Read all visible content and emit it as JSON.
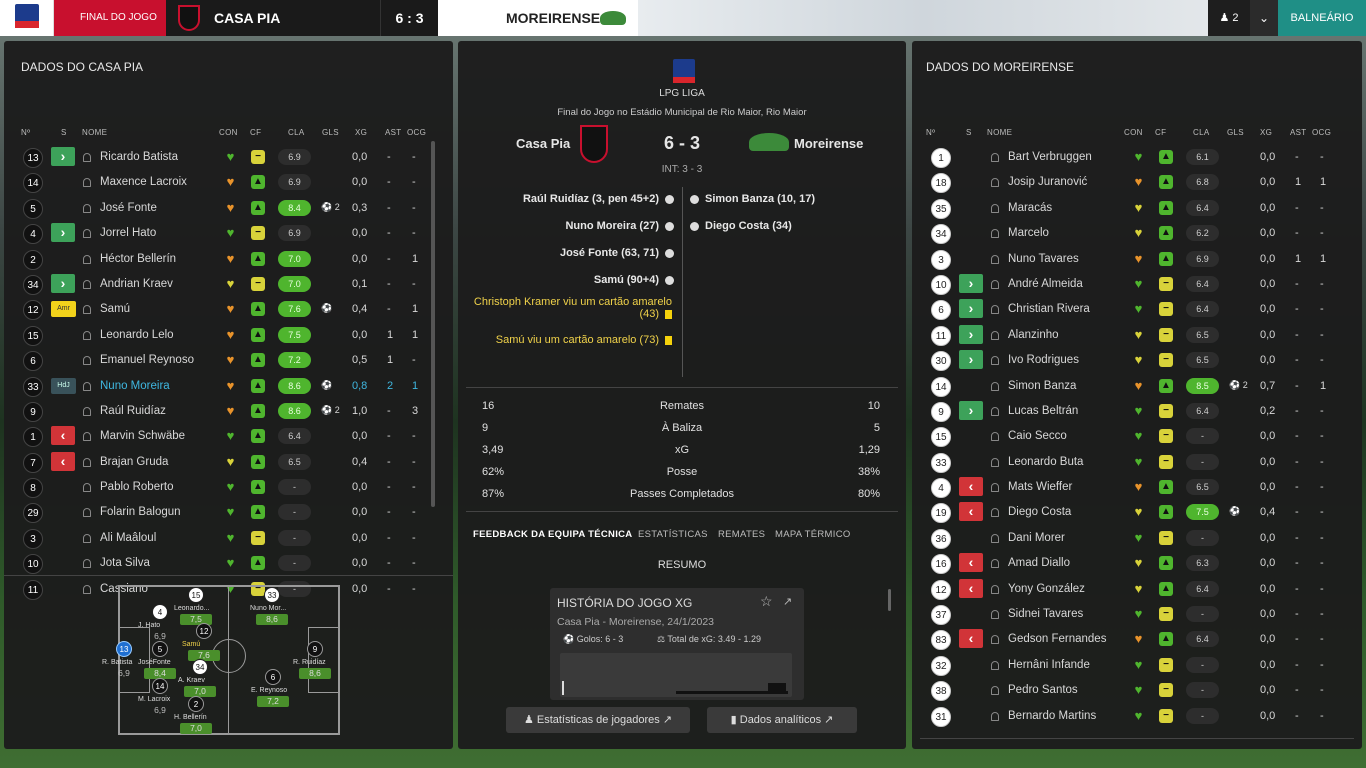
{
  "topbar": {
    "final_label": "FINAL DO JOGO",
    "home": "CASA PIA",
    "score": "6 : 3",
    "away": "MOREIRENSE",
    "users": "2",
    "balneario": "BALNEÁRIO"
  },
  "left": {
    "title": "DADOS DO CASA PIA",
    "headers": {
      "no": "Nº",
      "s": "S",
      "name": "NOME",
      "con": "CON",
      "cf": "CF",
      "cla": "CLA",
      "gls": "GLS",
      "xg": "XG",
      "ast": "AST",
      "ocg": "OCG"
    },
    "players": [
      {
        "no": "13",
        "sub": "in",
        "name": "Ricardo Batista",
        "con": "g",
        "cf": "y",
        "cla": "6.9",
        "gls": "",
        "xg": "0,0",
        "ast": "-",
        "ocg": "-"
      },
      {
        "no": "14",
        "sub": "",
        "name": "Maxence Lacroix",
        "con": "o",
        "cf": "g",
        "cla": "6.9",
        "gls": "",
        "xg": "0,0",
        "ast": "-",
        "ocg": "-"
      },
      {
        "no": "5",
        "sub": "",
        "name": "José Fonte",
        "con": "o",
        "cf": "g",
        "cla": "8.4",
        "gls": "2",
        "xg": "0,3",
        "ast": "-",
        "ocg": "-"
      },
      {
        "no": "4",
        "sub": "in",
        "name": "Jorrel Hato",
        "con": "g",
        "cf": "y",
        "cla": "6.9",
        "gls": "",
        "xg": "0,0",
        "ast": "-",
        "ocg": "-"
      },
      {
        "no": "2",
        "sub": "",
        "name": "Héctor Bellerín",
        "con": "o",
        "cf": "g",
        "cla": "7.0",
        "gls": "",
        "xg": "0,0",
        "ast": "-",
        "ocg": "1"
      },
      {
        "no": "34",
        "sub": "in",
        "name": "Andrian Kraev",
        "con": "y",
        "cf": "y",
        "cla": "7.0",
        "gls": "",
        "xg": "0,1",
        "ast": "-",
        "ocg": "-"
      },
      {
        "no": "12",
        "sub": "amr",
        "name": "Samú",
        "con": "o",
        "cf": "g",
        "cla": "7.6",
        "gls": "1",
        "xg": "0,4",
        "ast": "-",
        "ocg": "1"
      },
      {
        "no": "15",
        "sub": "",
        "name": "Leonardo Lelo",
        "con": "o",
        "cf": "g",
        "cla": "7.5",
        "gls": "",
        "xg": "0,0",
        "ast": "1",
        "ocg": "1"
      },
      {
        "no": "6",
        "sub": "",
        "name": "Emanuel Reynoso",
        "con": "o",
        "cf": "g",
        "cla": "7.2",
        "gls": "",
        "xg": "0,5",
        "ast": "1",
        "ocg": "-"
      },
      {
        "no": "33",
        "sub": "hdj",
        "name": "Nuno Moreira",
        "con": "o",
        "cf": "g",
        "cla": "8.6",
        "gls": "1",
        "xg": "0,8",
        "ast": "2",
        "ocg": "1"
      },
      {
        "no": "9",
        "sub": "",
        "name": "Raúl Ruidíaz",
        "con": "o",
        "cf": "g",
        "cla": "8.6",
        "gls": "2",
        "xg": "1,0",
        "ast": "-",
        "ocg": "3"
      },
      {
        "no": "1",
        "sub": "out",
        "name": "Marvin Schwäbe",
        "con": "g",
        "cf": "g",
        "cla": "6.4",
        "gls": "",
        "xg": "0,0",
        "ast": "-",
        "ocg": "-"
      },
      {
        "no": "7",
        "sub": "out",
        "name": "Brajan Gruda",
        "con": "y",
        "cf": "g",
        "cla": "6.5",
        "gls": "",
        "xg": "0,4",
        "ast": "-",
        "ocg": "-"
      },
      {
        "no": "8",
        "sub": "",
        "name": "Pablo Roberto",
        "con": "g",
        "cf": "g",
        "cla": "-",
        "gls": "",
        "xg": "0,0",
        "ast": "-",
        "ocg": "-"
      },
      {
        "no": "29",
        "sub": "",
        "name": "Folarin Balogun",
        "con": "g",
        "cf": "g",
        "cla": "-",
        "gls": "",
        "xg": "0,0",
        "ast": "-",
        "ocg": "-"
      },
      {
        "no": "3",
        "sub": "",
        "name": "Ali Maâloul",
        "con": "g",
        "cf": "y",
        "cla": "-",
        "gls": "",
        "xg": "0,0",
        "ast": "-",
        "ocg": "-"
      },
      {
        "no": "10",
        "sub": "",
        "name": "Jota Silva",
        "con": "g",
        "cf": "g",
        "cla": "-",
        "gls": "",
        "xg": "0,0",
        "ast": "-",
        "ocg": "-"
      },
      {
        "no": "11",
        "sub": "",
        "name": "Cassiano",
        "con": "g",
        "cf": "y",
        "cla": "-",
        "gls": "",
        "xg": "0,0",
        "ast": "-",
        "ocg": "-"
      }
    ],
    "formation": [
      {
        "no": "15",
        "name": "Leonardo...",
        "rating": "7,5"
      },
      {
        "no": "33",
        "name": "Nuno Mor...",
        "rating": "8,6"
      },
      {
        "no": "4",
        "name": "J. Hato",
        "rating": "6,9"
      },
      {
        "no": "12",
        "name": "Samú",
        "rating": "7,6"
      },
      {
        "no": "13",
        "name": "R. Batista",
        "rating": "6,9"
      },
      {
        "no": "5",
        "name": "JoséFonte",
        "rating": "8,4"
      },
      {
        "no": "34",
        "name": "A. Kraev",
        "rating": "7,0"
      },
      {
        "no": "9",
        "name": "R. Ruidíaz",
        "rating": "8,6"
      },
      {
        "no": "14",
        "name": "M. Lacroix",
        "rating": "6,9"
      },
      {
        "no": "6",
        "name": "E. Reynoso",
        "rating": "7,2"
      },
      {
        "no": "2",
        "name": "H. Bellerín",
        "rating": "7,0"
      }
    ]
  },
  "center": {
    "league": "LPG LIGA",
    "subtitle": "Final do Jogo no Estádio Municipal de Rio Maior, Rio Maior",
    "home": "Casa Pia",
    "away": "Moreirense",
    "score": "6 - 3",
    "int": "INT: 3 - 3",
    "home_events": [
      "Raúl Ruidíaz (3, pen 45+2)",
      "Nuno Moreira (27)",
      "José Fonte (63, 71)",
      "Samú (90+4)"
    ],
    "cards": [
      "Christoph Kramer viu um cartão amarelo (43)",
      "Samú viu um cartão amarelo (73)"
    ],
    "away_events": [
      "Simon Banza (10, 17)",
      "Diego Costa (34)"
    ],
    "stats": [
      {
        "home": "16",
        "label": "Remates",
        "away": "10"
      },
      {
        "home": "9",
        "label": "À Baliza",
        "away": "5"
      },
      {
        "home": "3,49",
        "label": "xG",
        "away": "1,29"
      },
      {
        "home": "62%",
        "label": "Posse",
        "away": "38%"
      },
      {
        "home": "87%",
        "label": "Passes Completados",
        "away": "80%"
      }
    ],
    "tabs": [
      "FEEDBACK DA EQUIPA TÉCNICA",
      "ESTATÍSTICAS",
      "REMATES",
      "MAPA TÉRMICO"
    ],
    "resumo": "RESUMO",
    "card_title": "HISTÓRIA DO JOGO XG",
    "card_sub": "Casa Pia - Moreirense, 24/1/2023",
    "goals": "Golos: 6 - 3",
    "total_xg": "Total de xG: 3.49 - 1.29",
    "btn1": "Estatísticas de jogadores",
    "btn2": "Dados analíticos"
  },
  "right": {
    "title": "DADOS DO MOREIRENSE",
    "players": [
      {
        "no": "1",
        "sub": "",
        "name": "Bart Verbruggen",
        "con": "g",
        "cf": "g",
        "cla": "6.1",
        "gls": "",
        "xg": "0,0",
        "ast": "-",
        "ocg": "-"
      },
      {
        "no": "18",
        "sub": "",
        "name": "Josip Juranović",
        "con": "o",
        "cf": "g",
        "cla": "6.8",
        "gls": "",
        "xg": "0,0",
        "ast": "1",
        "ocg": "1"
      },
      {
        "no": "35",
        "sub": "",
        "name": "Maracás",
        "con": "y",
        "cf": "g",
        "cla": "6.4",
        "gls": "",
        "xg": "0,0",
        "ast": "-",
        "ocg": "-"
      },
      {
        "no": "34",
        "sub": "",
        "name": "Marcelo",
        "con": "y",
        "cf": "g",
        "cla": "6.2",
        "gls": "",
        "xg": "0,0",
        "ast": "-",
        "ocg": "-"
      },
      {
        "no": "3",
        "sub": "",
        "name": "Nuno Tavares",
        "con": "o",
        "cf": "g",
        "cla": "6.9",
        "gls": "",
        "xg": "0,0",
        "ast": "1",
        "ocg": "1"
      },
      {
        "no": "10",
        "sub": "in",
        "name": "André Almeida",
        "con": "g",
        "cf": "y",
        "cla": "6.4",
        "gls": "",
        "xg": "0,0",
        "ast": "-",
        "ocg": "-"
      },
      {
        "no": "6",
        "sub": "in",
        "name": "Christian Rivera",
        "con": "g",
        "cf": "y",
        "cla": "6.4",
        "gls": "",
        "xg": "0,0",
        "ast": "-",
        "ocg": "-"
      },
      {
        "no": "11",
        "sub": "in",
        "name": "Alanzinho",
        "con": "y",
        "cf": "y",
        "cla": "6.5",
        "gls": "",
        "xg": "0,0",
        "ast": "-",
        "ocg": "-"
      },
      {
        "no": "30",
        "sub": "in",
        "name": "Ivo Rodrigues",
        "con": "y",
        "cf": "y",
        "cla": "6.5",
        "gls": "",
        "xg": "0,0",
        "ast": "-",
        "ocg": "-"
      },
      {
        "no": "14",
        "sub": "",
        "name": "Simon Banza",
        "con": "o",
        "cf": "g",
        "cla": "8.5",
        "gls": "2",
        "xg": "0,7",
        "ast": "-",
        "ocg": "1"
      },
      {
        "no": "9",
        "sub": "in",
        "name": "Lucas Beltrán",
        "con": "g",
        "cf": "y",
        "cla": "6.4",
        "gls": "",
        "xg": "0,2",
        "ast": "-",
        "ocg": "-"
      },
      {
        "no": "15",
        "sub": "",
        "name": "Caio Secco",
        "con": "g",
        "cf": "y",
        "cla": "-",
        "gls": "",
        "xg": "0,0",
        "ast": "-",
        "ocg": "-"
      },
      {
        "no": "33",
        "sub": "",
        "name": "Leonardo Buta",
        "con": "g",
        "cf": "y",
        "cla": "-",
        "gls": "",
        "xg": "0,0",
        "ast": "-",
        "ocg": "-"
      },
      {
        "no": "4",
        "sub": "out",
        "name": "Mats Wieffer",
        "con": "o",
        "cf": "g",
        "cla": "6.5",
        "gls": "",
        "xg": "0,0",
        "ast": "-",
        "ocg": "-"
      },
      {
        "no": "19",
        "sub": "out",
        "name": "Diego Costa",
        "con": "y",
        "cf": "g",
        "cla": "7.5",
        "gls": "1",
        "xg": "0,4",
        "ast": "-",
        "ocg": "-"
      },
      {
        "no": "36",
        "sub": "",
        "name": "Dani Morer",
        "con": "g",
        "cf": "y",
        "cla": "-",
        "gls": "",
        "xg": "0,0",
        "ast": "-",
        "ocg": "-"
      },
      {
        "no": "16",
        "sub": "out",
        "name": "Amad Diallo",
        "con": "y",
        "cf": "g",
        "cla": "6.3",
        "gls": "",
        "xg": "0,0",
        "ast": "-",
        "ocg": "-"
      },
      {
        "no": "12",
        "sub": "out",
        "name": "Yony González",
        "con": "y",
        "cf": "g",
        "cla": "6.4",
        "gls": "",
        "xg": "0,0",
        "ast": "-",
        "ocg": "-"
      },
      {
        "no": "37",
        "sub": "",
        "name": "Sidnei Tavares",
        "con": "g",
        "cf": "y",
        "cla": "-",
        "gls": "",
        "xg": "0,0",
        "ast": "-",
        "ocg": "-"
      },
      {
        "no": "83",
        "sub": "out",
        "name": "Gedson Fernandes",
        "con": "o",
        "cf": "g",
        "cla": "6.4",
        "gls": "",
        "xg": "0,0",
        "ast": "-",
        "ocg": "-"
      },
      {
        "no": "32",
        "sub": "",
        "name": "Hernâni Infande",
        "con": "g",
        "cf": "y",
        "cla": "-",
        "gls": "",
        "xg": "0,0",
        "ast": "-",
        "ocg": "-"
      },
      {
        "no": "38",
        "sub": "",
        "name": "Pedro Santos",
        "con": "g",
        "cf": "y",
        "cla": "-",
        "gls": "",
        "xg": "0,0",
        "ast": "-",
        "ocg": "-"
      },
      {
        "no": "31",
        "sub": "",
        "name": "Bernardo Martins",
        "con": "g",
        "cf": "y",
        "cla": "-",
        "gls": "",
        "xg": "0,0",
        "ast": "-",
        "ocg": "-"
      }
    ]
  },
  "colors": {
    "in": "#3da25a",
    "out": "#d13438",
    "green": "#4fb52e",
    "orange": "#e8932b",
    "yellow": "#d8d23a",
    "accent": "#1f8f86"
  }
}
